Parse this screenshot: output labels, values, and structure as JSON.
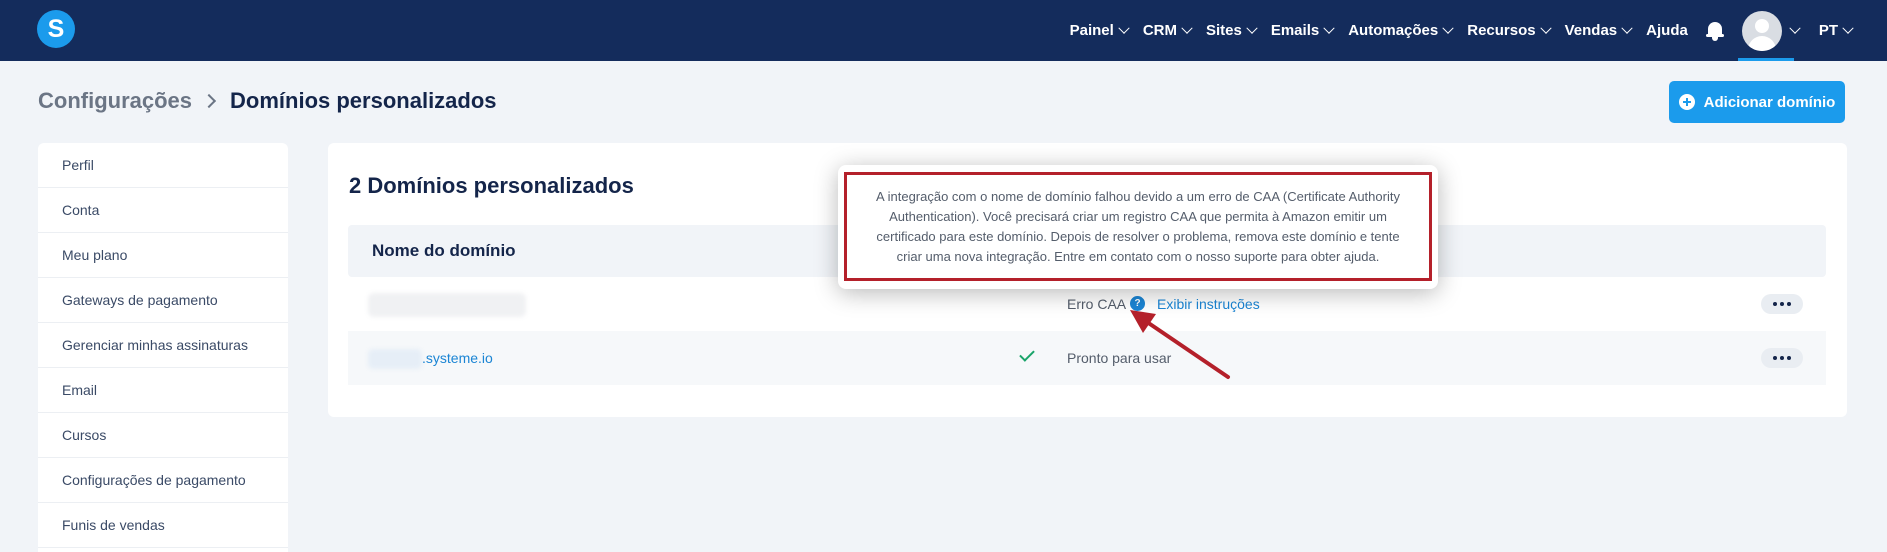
{
  "topbar": {
    "logo_letter": "S",
    "nav_items": [
      {
        "label": "Painel",
        "has_dropdown": true
      },
      {
        "label": "CRM",
        "has_dropdown": true
      },
      {
        "label": "Sites",
        "has_dropdown": true
      },
      {
        "label": "Emails",
        "has_dropdown": true
      },
      {
        "label": "Automações",
        "has_dropdown": true
      },
      {
        "label": "Recursos",
        "has_dropdown": true
      },
      {
        "label": "Vendas",
        "has_dropdown": true
      },
      {
        "label": "Ajuda",
        "has_dropdown": false
      }
    ],
    "language": "PT"
  },
  "header": {
    "breadcrumb_parent": "Configurações",
    "breadcrumb_current": "Domínios personalizados",
    "add_button_label": "Adicionar domínio"
  },
  "sidebar": {
    "items": [
      {
        "label": "Perfil"
      },
      {
        "label": "Conta"
      },
      {
        "label": "Meu plano"
      },
      {
        "label": "Gateways de pagamento"
      },
      {
        "label": "Gerenciar minhas assinaturas"
      },
      {
        "label": "Email"
      },
      {
        "label": "Cursos"
      },
      {
        "label": "Configurações de pagamento"
      },
      {
        "label": "Funis de vendas"
      }
    ]
  },
  "main": {
    "title": "2 Domínios personalizados",
    "table": {
      "column_name": "Nome do domínio",
      "rows": [
        {
          "domain": "",
          "status": "Erro CAA",
          "action_link": "Exibir instruções"
        },
        {
          "domain": ".systeme.io",
          "status": "Pronto para usar"
        }
      ]
    }
  },
  "tooltip": {
    "text": "A integração com o nome de domínio falhou devido a um erro de CAA (Certificate Authority Authentication). Você precisará criar um registro CAA que permita à Amazon emitir um certificado para este domínio. Depois de resolver o problema, remova este domínio e tente criar uma nova integração. Entre em contato com o nosso suporte para obter ajuda."
  },
  "colors": {
    "nav_bg": "#142c5c",
    "accent": "#1b9bec",
    "link": "#1b85d4",
    "annotation_red": "#b4202a",
    "success_green": "#1aa46a"
  }
}
